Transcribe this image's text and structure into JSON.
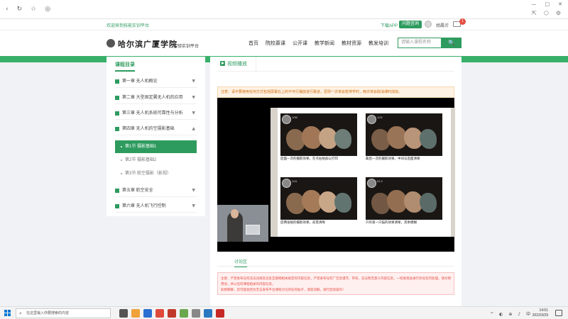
{
  "browser": {
    "nav_icons": [
      "back-icon",
      "reload-icon",
      "favorite-icon",
      "globe-icon"
    ],
    "window_controls": [
      "—",
      "□",
      "✕"
    ],
    "right_icons": [
      "share-icon",
      "extension-icon",
      "settings-icon"
    ]
  },
  "topbar": {
    "welcome": "欢迎来到技能实训平台",
    "download_app": "下载APP",
    "consult": "问题咨询",
    "username": "胡晨沂",
    "message_count": "1"
  },
  "header": {
    "logo_text": "哈尔滨广厦学院",
    "logo_sub": "实验实训平台",
    "nav": [
      "首页",
      "院校慕课",
      "公开课",
      "教学新闻",
      "教材资源",
      "教发培训"
    ],
    "search_placeholder": "请输入课程名称",
    "search_button": "🔍"
  },
  "sidebar": {
    "title": "课程目录",
    "chapters": [
      {
        "label": "第一章  无人机概论",
        "arrow": "▼"
      },
      {
        "label": "第二章  大型固定翼无人机的应用",
        "arrow": "▼"
      },
      {
        "label": "第三章  无人机系统可靠性与分析",
        "arrow": "▼"
      },
      {
        "label": "第四章  无人机的空摄影基础",
        "arrow": "▲"
      }
    ],
    "sections": [
      {
        "label": "第1节  摄影基础1"
      },
      {
        "label": "第2节  摄影基础2"
      },
      {
        "label": "第3节  航空摄影（影视）"
      }
    ],
    "chapters_after": [
      {
        "label": "第五章  航空安全",
        "arrow": "▼"
      },
      {
        "label": "第六章  无人机飞行控制",
        "arrow": "▼"
      }
    ]
  },
  "content": {
    "tab_video": "视频播放",
    "notice_top": "注意：请不要使用任何方式包括屏幕右上的不可行播放进行跳进，否则一次将会暂停学时，两次将会取消课时成绩。",
    "slide_panels": [
      {
        "tag": "1/36",
        "caption": "后面一次的摄影效果，在点右拍加以打印"
      },
      {
        "tag": "1/22",
        "caption": "最后一次的摄影效果，中间与后面清晰"
      },
      {
        "tag": "1/11",
        "caption": "后两张拍的摄影效果，前景清晰"
      },
      {
        "tag": "f/2.2",
        "caption": "只有第一只猫的效果清晰，其余模糊"
      }
    ],
    "discuss_tab": "讨论区",
    "notice_bottom_1": "注意：严禁发布任何违法违规及违反互联网相关规定的内容信息，严禁发布任何广告及谩骂、带有、违法和无意义内容信息，一经发现会进行封号惩罚处理，请文明用语，并以任何课程相关的内容信息。",
    "notice_bottom_2": "如想聊聊，您可能会因为无法发布平台课程讨论的任何帖子，请您谅解。进行后续操作！"
  },
  "taskbar": {
    "search_placeholder": "在这里输入你要搜索的内容",
    "tray": "^ ◐ ⊕ ♪ 中",
    "time": "14:51",
    "date": "2022/3/29",
    "app_colors": [
      "#555555",
      "#f0a23a",
      "#2c6fd1",
      "#e04a3a",
      "#c0392b",
      "#6aa84f",
      "#888888",
      "#2b78c2",
      "#c62828"
    ]
  },
  "colors": {
    "brand_green": "#2e9b5e",
    "warn_orange": "#d46b08",
    "error_red": "#e54d42"
  }
}
